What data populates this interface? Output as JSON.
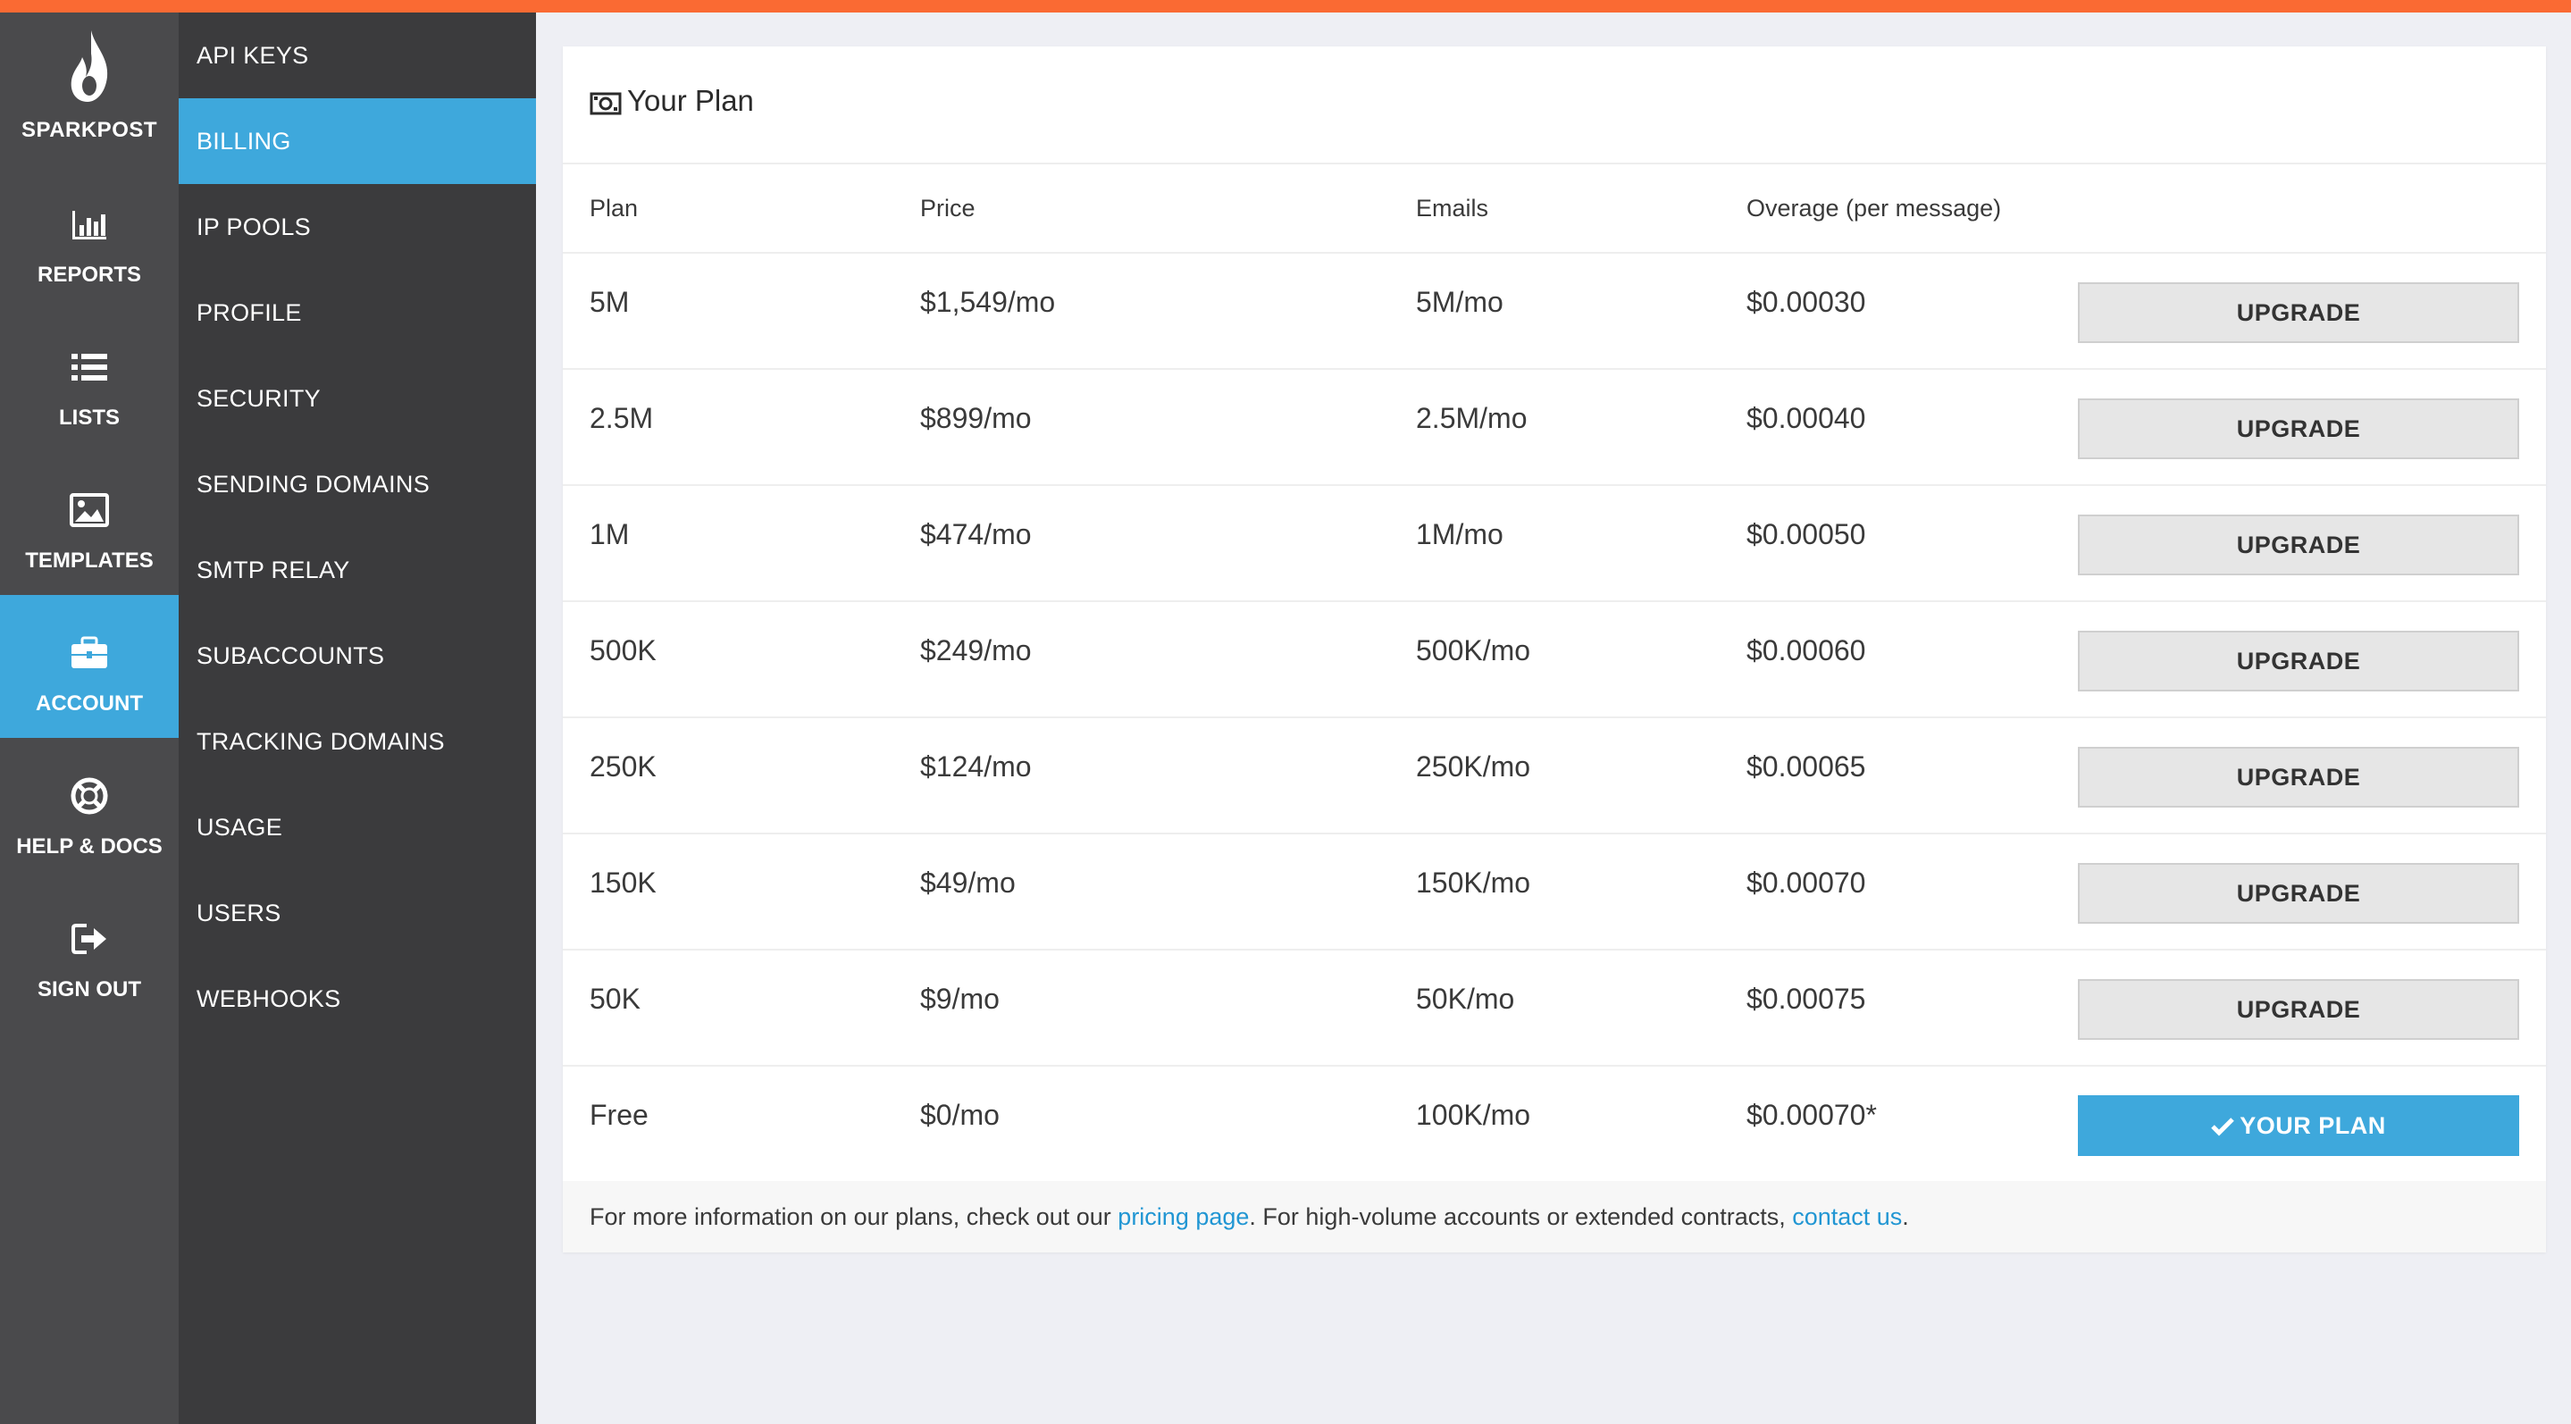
{
  "brand": {
    "name": "SPARKPOST"
  },
  "colors": {
    "accent": "#fa6a33",
    "active": "#3ea8dc",
    "link": "#2196d3"
  },
  "primary_nav": [
    {
      "label": "REPORTS",
      "icon": "bar-chart-icon"
    },
    {
      "label": "LISTS",
      "icon": "list-icon"
    },
    {
      "label": "TEMPLATES",
      "icon": "image-icon"
    },
    {
      "label": "ACCOUNT",
      "icon": "briefcase-icon",
      "active": true
    },
    {
      "label": "HELP & DOCS",
      "icon": "lifebuoy-icon"
    },
    {
      "label": "SIGN OUT",
      "icon": "sign-out-icon"
    }
  ],
  "secondary_nav": [
    {
      "label": "API KEYS"
    },
    {
      "label": "BILLING",
      "active": true
    },
    {
      "label": "IP POOLS"
    },
    {
      "label": "PROFILE"
    },
    {
      "label": "SECURITY"
    },
    {
      "label": "SENDING DOMAINS"
    },
    {
      "label": "SMTP RELAY"
    },
    {
      "label": "SUBACCOUNTS"
    },
    {
      "label": "TRACKING DOMAINS"
    },
    {
      "label": "USAGE"
    },
    {
      "label": "USERS"
    },
    {
      "label": "WEBHOOKS"
    }
  ],
  "card": {
    "title": "Your Plan",
    "columns": {
      "plan": "Plan",
      "price": "Price",
      "emails": "Emails",
      "overage": "Overage (per message)"
    },
    "rows": [
      {
        "plan": "5M",
        "price": "$1,549/mo",
        "emails": "5M/mo",
        "overage": "$0.00030",
        "action": "UPGRADE"
      },
      {
        "plan": "2.5M",
        "price": "$899/mo",
        "emails": "2.5M/mo",
        "overage": "$0.00040",
        "action": "UPGRADE"
      },
      {
        "plan": "1M",
        "price": "$474/mo",
        "emails": "1M/mo",
        "overage": "$0.00050",
        "action": "UPGRADE"
      },
      {
        "plan": "500K",
        "price": "$249/mo",
        "emails": "500K/mo",
        "overage": "$0.00060",
        "action": "UPGRADE"
      },
      {
        "plan": "250K",
        "price": "$124/mo",
        "emails": "250K/mo",
        "overage": "$0.00065",
        "action": "UPGRADE"
      },
      {
        "plan": "150K",
        "price": "$49/mo",
        "emails": "150K/mo",
        "overage": "$0.00070",
        "action": "UPGRADE"
      },
      {
        "plan": "50K",
        "price": "$9/mo",
        "emails": "50K/mo",
        "overage": "$0.00075",
        "action": "UPGRADE"
      },
      {
        "plan": "Free",
        "price": "$0/mo",
        "emails": "100K/mo",
        "overage": "$0.00070*",
        "action": "YOUR PLAN"
      }
    ],
    "footer": {
      "text_before": "For more information on our plans, check out our ",
      "pricing_link": "pricing page",
      "text_middle": ". For high-volume accounts or extended contracts, ",
      "contact_link": "contact us",
      "text_after": "."
    }
  }
}
